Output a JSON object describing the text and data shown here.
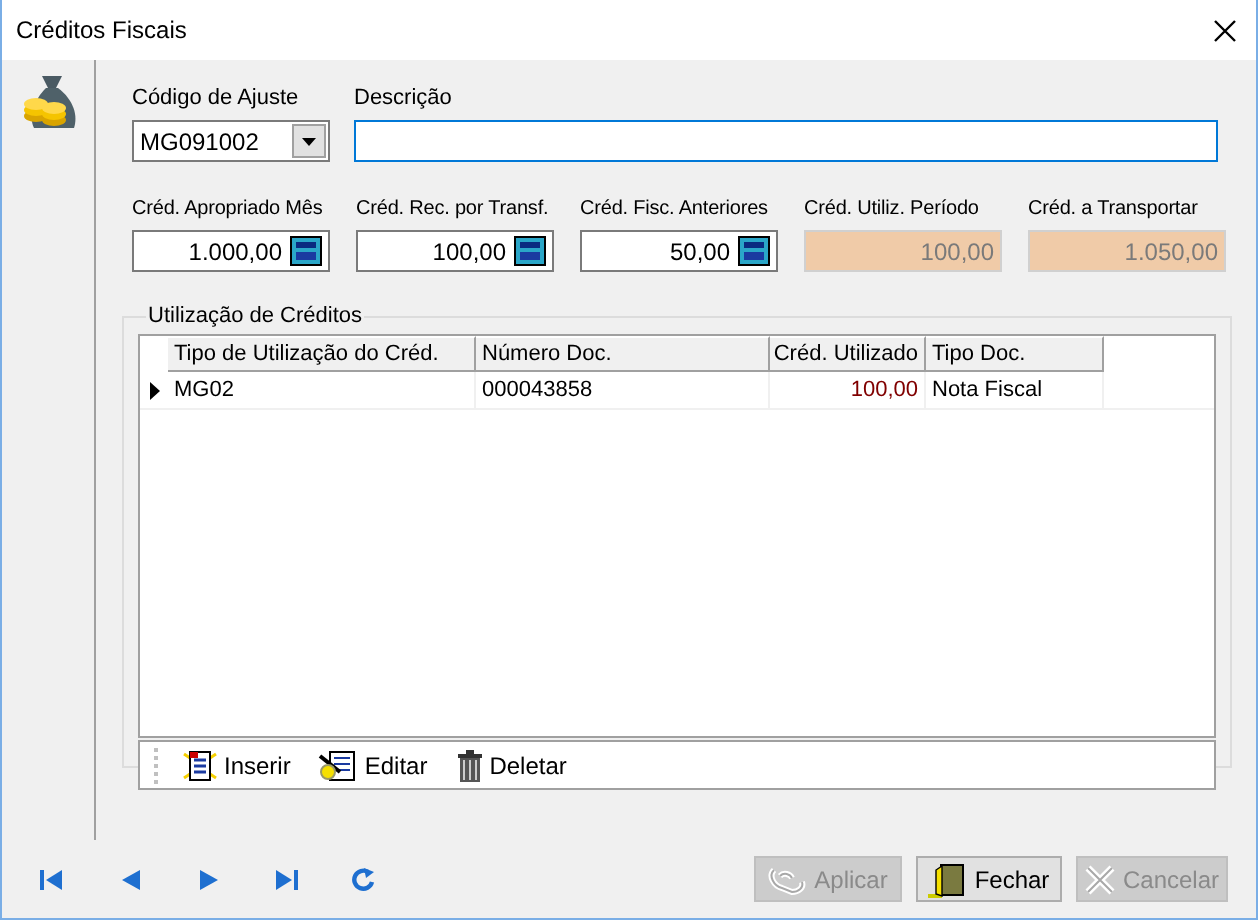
{
  "window": {
    "title": "Créditos Fiscais"
  },
  "ajuste": {
    "label": "Código de Ajuste",
    "value": "MG091002"
  },
  "descricao": {
    "label": "Descrição"
  },
  "values": [
    {
      "label": "Créd. Apropriado Mês",
      "value": "1.000,00",
      "disabled": false
    },
    {
      "label": "Créd. Rec. por Transf.",
      "value": "100,00",
      "disabled": false
    },
    {
      "label": "Créd. Fisc. Anteriores",
      "value": "50,00",
      "disabled": false
    },
    {
      "label": "Créd. Utiliz.  Período",
      "value": "100,00",
      "disabled": true
    },
    {
      "label": "Créd. a Transportar",
      "value": "1.050,00",
      "disabled": true
    }
  ],
  "group": {
    "title": "Utilização de Créditos",
    "columns": [
      "Tipo de Utilização do Créd.",
      "Número Doc.",
      "Créd. Utilizado",
      "Tipo Doc."
    ],
    "rows": [
      {
        "selected": true,
        "cells": [
          "MG02",
          "000043858",
          "100,00",
          "Nota Fiscal"
        ]
      }
    ]
  },
  "toolbar": [
    {
      "kind": "insert",
      "label": "Inserir"
    },
    {
      "kind": "edit",
      "label": "Editar"
    },
    {
      "kind": "delete",
      "label": "Deletar"
    }
  ],
  "nav": [
    {
      "kind": "first"
    },
    {
      "kind": "prev"
    },
    {
      "kind": "next"
    },
    {
      "kind": "last"
    },
    {
      "kind": "refresh"
    }
  ],
  "buttons": [
    {
      "kind": "apply",
      "label": "Aplicar",
      "disabled": true
    },
    {
      "kind": "close",
      "label": "Fechar",
      "disabled": false
    },
    {
      "kind": "cancel",
      "label": "Cancelar",
      "disabled": true
    }
  ]
}
